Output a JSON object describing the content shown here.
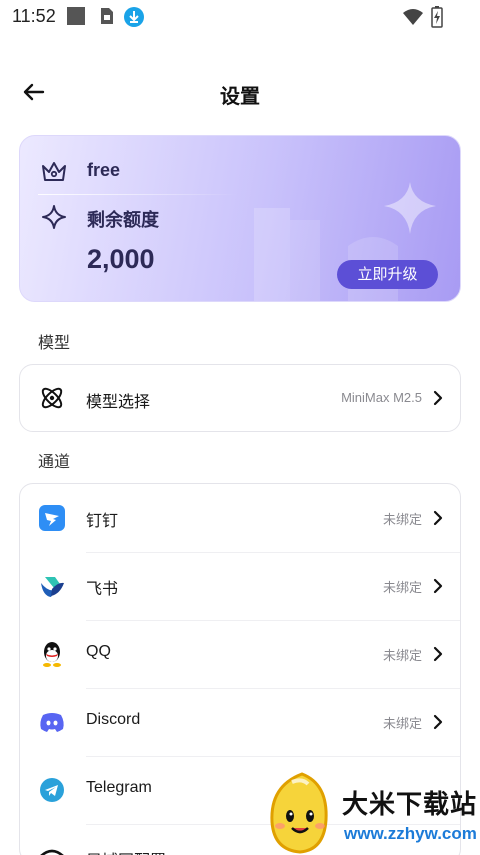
{
  "status_bar": {
    "time": "11:52",
    "icons": [
      "gallery-icon",
      "sim-icon",
      "download-icon",
      "wifi-icon",
      "battery-icon"
    ]
  },
  "header": {
    "title": "设置"
  },
  "plan_card": {
    "plan_name": "free",
    "quota_label": "剩余额度",
    "quota_value": "2,000",
    "upgrade_label": "立即升级",
    "accent_color": "#5c4fd6"
  },
  "sections": {
    "model_title": "模型",
    "channel_title": "通道"
  },
  "model": {
    "label": "模型选择",
    "value": "MiniMax M2.5"
  },
  "channels": [
    {
      "label": "钉钉",
      "status": "未绑定",
      "icon": "dingtalk-icon"
    },
    {
      "label": "飞书",
      "status": "未绑定",
      "icon": "feishu-icon"
    },
    {
      "label": "QQ",
      "status": "未绑定",
      "icon": "qq-icon"
    },
    {
      "label": "Discord",
      "status": "未绑定",
      "icon": "discord-icon"
    },
    {
      "label": "Telegram",
      "status": "",
      "icon": "telegram-icon"
    },
    {
      "label": "局域网配置",
      "status": "",
      "icon": "lan-icon"
    }
  ],
  "watermark": {
    "title": "大米下载站",
    "url": "www.zzhyw.com"
  }
}
